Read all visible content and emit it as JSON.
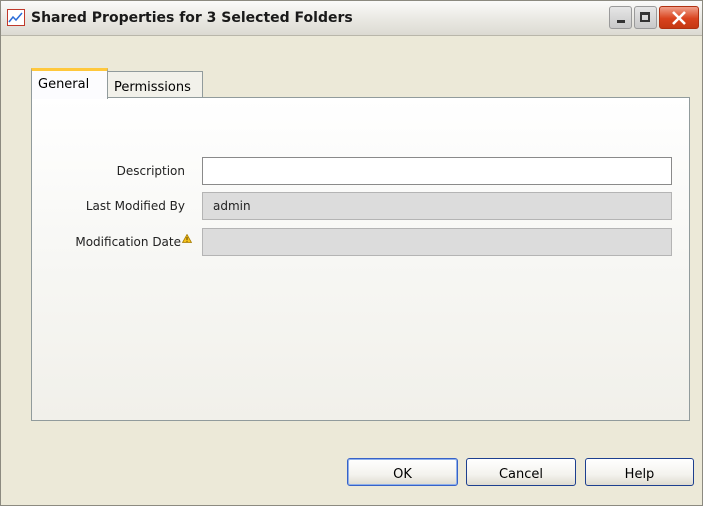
{
  "window": {
    "title": "Shared Properties for 3 Selected Folders",
    "icon": "chart-line-icon"
  },
  "tabs": [
    {
      "label": "General",
      "selected": true
    },
    {
      "label": "Permissions",
      "selected": false
    }
  ],
  "form": {
    "description": {
      "label": "Description",
      "value": ""
    },
    "last_modified_by": {
      "label": "Last Modified By",
      "value": "admin"
    },
    "modification_date": {
      "label": "Modification Date",
      "value": "",
      "icon": "warning-icon"
    }
  },
  "buttons": {
    "ok": "OK",
    "cancel": "Cancel",
    "help": "Help"
  },
  "colors": {
    "tab_accent": "#ffc83c",
    "close_button": "#d9431e",
    "default_button_border": "#3762c8"
  }
}
